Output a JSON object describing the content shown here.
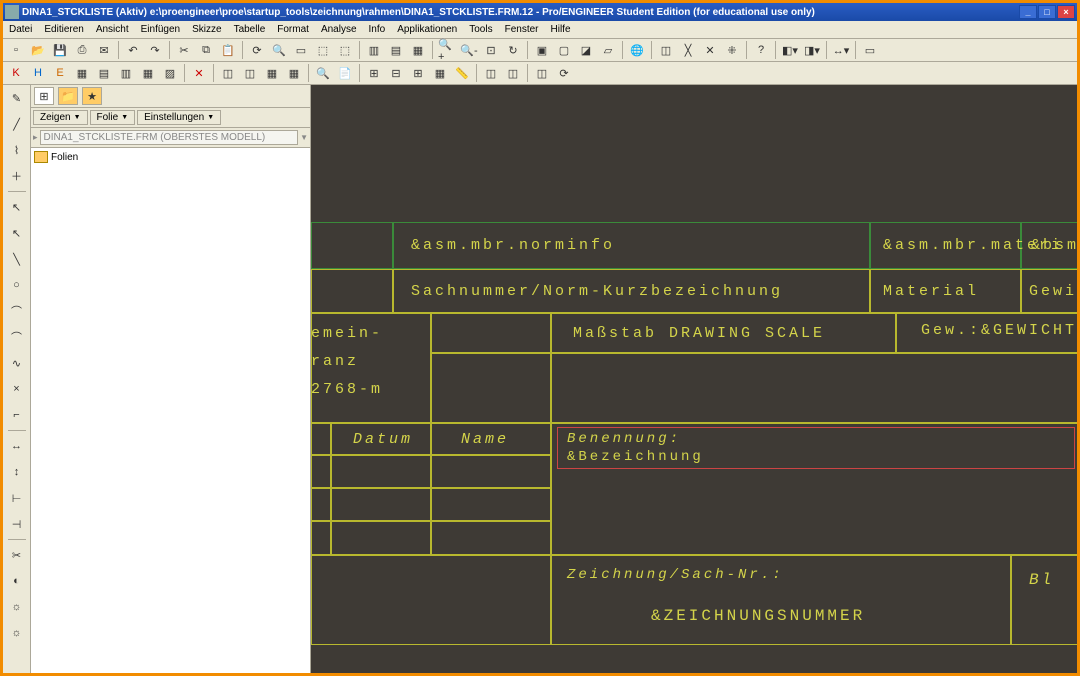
{
  "titlebar": {
    "text": "DINA1_STCKLISTE (Aktiv) e:\\proengineer\\proe\\startup_tools\\zeichnung\\rahmen\\DINA1_STCKLISTE.FRM.12 - Pro/ENGINEER Student Edition (for educational use only)"
  },
  "menu": [
    "Datei",
    "Editieren",
    "Ansicht",
    "Einfügen",
    "Skizze",
    "Tabelle",
    "Format",
    "Analyse",
    "Info",
    "Applikationen",
    "Tools",
    "Fenster",
    "Hilfe"
  ],
  "panel": {
    "btn_zeigen": "Zeigen",
    "btn_folie": "Folie",
    "btn_einstellungen": "Einstellungen",
    "input_val": "DINA1_STCKLISTE.FRM (OBERSTES MODELL)",
    "tree_item": "Folien"
  },
  "drawing": {
    "row1_a": "&asm.mbr.norminfo",
    "row1_b": "&asm.mbr.materi",
    "row1_c": "&bsm",
    "row2_a": "Sachnummer/Norm-Kurzbezeichnung",
    "row2_b": "Material",
    "row2_c": "Gewi",
    "block_left1": "emein-",
    "block_left2": "ranz",
    "block_left3": "2768-m",
    "massstab": "Maßstab DRAWING SCALE",
    "gewicht": "Gew.:&GEWICHTk",
    "datum": "Datum",
    "name": "Name",
    "benennung1": "Benennung:",
    "benennung2": "&Bezeichnung",
    "zeichnung": "Zeichnung/Sach-Nr.:",
    "znummer": "&ZEICHNUNGSNUMMER",
    "bl": "Bl"
  }
}
